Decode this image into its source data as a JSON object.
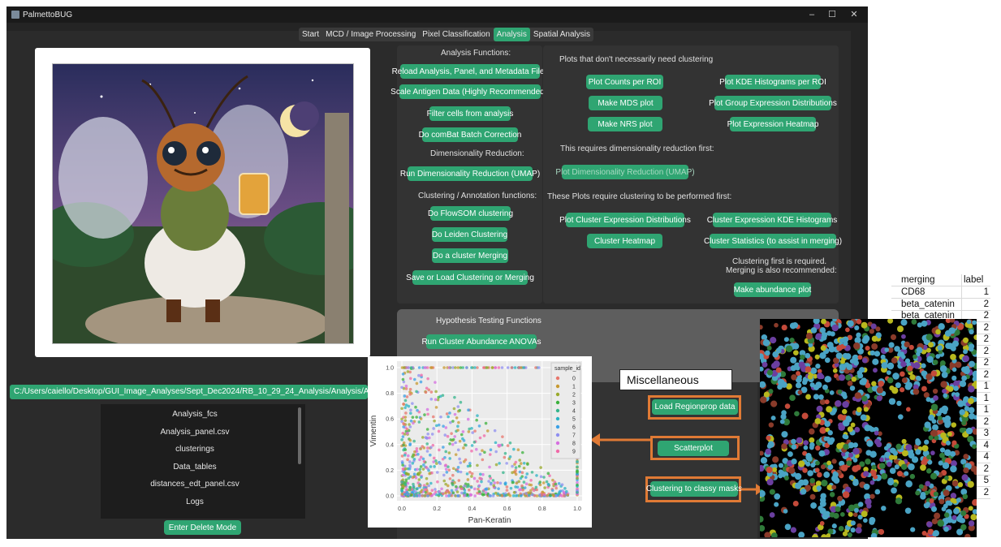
{
  "window": {
    "title": "PalmettoBUG",
    "controls": [
      "–",
      "☐",
      "✕"
    ]
  },
  "tabs": [
    "Start",
    "MCD / Image Processing",
    "Pixel Classification",
    "Analysis",
    "Spatial Analysis"
  ],
  "active_tab": "Analysis",
  "left_panel": {
    "path": "C:/Users/caiello/Desktop/GUI_Image_Analyses/Sept_Dec2024/RB_10_29_24_Analysis/Analysis/Analyses/Analysis",
    "files": [
      "Analysis_fcs",
      "Analysis_panel.csv",
      "clusterings",
      "Data_tables",
      "distances_edt_panel.csv",
      "Logs"
    ],
    "delete_button": "Enter Delete Mode"
  },
  "analysis_functions": {
    "header": "Analysis Functions:",
    "buttons": [
      "Reload Analysis, Panel, and Metadata Files",
      "Scale Antigen Data (Highly Recommended!)",
      "Filter cells from analysis",
      "Do comBat Batch Correction"
    ],
    "dimred_header": "Dimensionality Reduction:",
    "dimred_button": "Run Dimensionality Reduction (UMAP)",
    "cluster_header": "Clustering / Annotation functions:",
    "cluster_buttons": [
      "Do FlowSOM clustering",
      "Do Leiden Clustering",
      "Do a cluster Merging",
      "Save or Load Clustering or Merging"
    ]
  },
  "plots": {
    "noclust_header": "Plots that don't necessarily need clustering",
    "noclust_left": [
      "Plot Counts per ROI",
      "Make MDS plot",
      "Make NRS plot"
    ],
    "noclust_right": [
      "Plot KDE Histograms per ROI",
      "Plot Group Expression Distributions",
      "Plot Expression Heatmap"
    ],
    "dimred_header": "This requires dimensionality reduction first:",
    "dimred_button": "Plot Dimensionality Reduction (UMAP)",
    "clust_header": "These Plots require clustering to be performed first:",
    "clust_left": [
      "Plot Cluster Expression Distributions",
      "Cluster Heatmap"
    ],
    "clust_right": [
      "Cluster Expression KDE Histograms",
      "Cluster Statistics (to assist in merging)"
    ],
    "abund_note_1": "Clustering first is required.",
    "abund_note_2": "Merging is also recommended:",
    "abund_button": "Make abundance plot"
  },
  "hypothesis": {
    "header": "Hypothesis Testing Functions",
    "button": "Run Cluster Abundance ANOVAs"
  },
  "miscellaneous": {
    "label": "Miscellaneous",
    "buttons": [
      "Load Regionprop data",
      "Scatterplot",
      "Clustering to classy masks"
    ]
  },
  "scatter_inset": {
    "xlabel": "Pan-Keratin",
    "ylabel": "Vimentin",
    "legend_title": "sample_id",
    "legend": [
      "0",
      "1",
      "2",
      "3",
      "4",
      "5",
      "6",
      "7",
      "8",
      "9"
    ],
    "xticks": [
      "0.0",
      "0.2",
      "0.4",
      "0.6",
      "0.8",
      "1.0"
    ],
    "yticks": [
      "0.0",
      "0.2",
      "0.4",
      "0.6",
      "0.8",
      "1.0"
    ],
    "colors": [
      "#e8766c",
      "#c79a32",
      "#9aaa2c",
      "#3cb13c",
      "#35b58c",
      "#2ab3c3",
      "#3aa0e6",
      "#8f8ff0",
      "#d66fe0",
      "#f06aa8"
    ]
  },
  "sheet": {
    "headers": [
      "merging",
      "label"
    ],
    "rows": [
      [
        "CD68",
        "1"
      ],
      [
        "beta_catenin",
        "2"
      ],
      [
        "beta_catenin",
        "2"
      ],
      [
        "",
        "2"
      ],
      [
        "",
        "2"
      ],
      [
        "",
        "2"
      ],
      [
        "",
        "2"
      ],
      [
        "",
        "2"
      ],
      [
        "",
        "1"
      ],
      [
        "",
        "1"
      ],
      [
        "",
        "1"
      ],
      [
        "",
        "2"
      ],
      [
        "",
        "3"
      ],
      [
        "",
        "4"
      ],
      [
        "",
        "4"
      ],
      [
        "",
        "2"
      ],
      [
        "",
        "5"
      ],
      [
        "",
        "2"
      ]
    ]
  }
}
